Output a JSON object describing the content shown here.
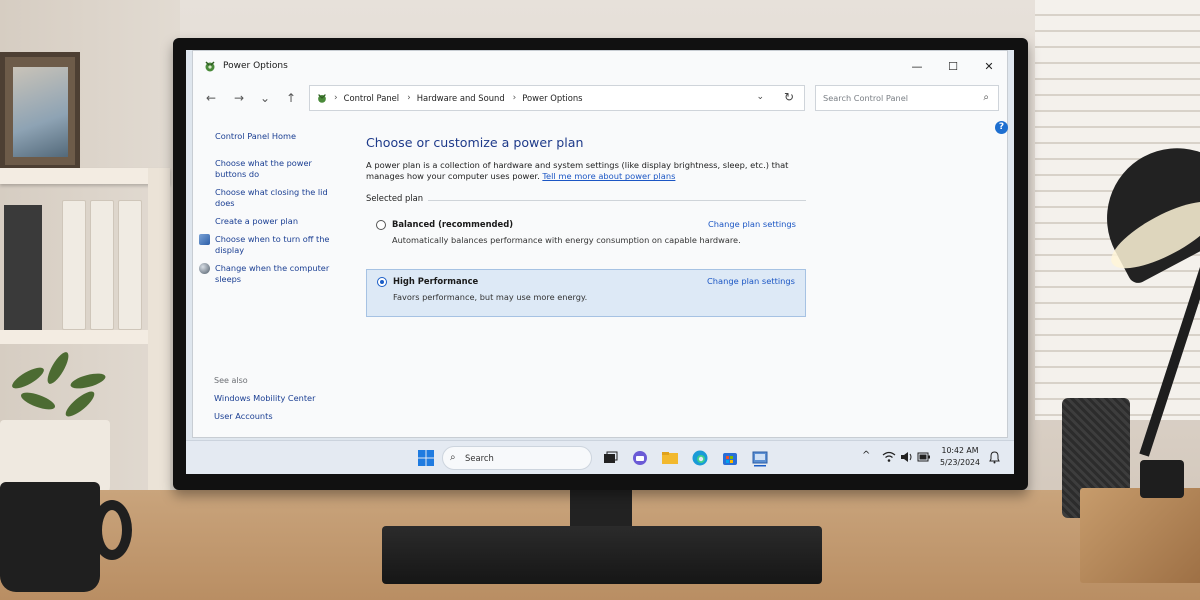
{
  "window": {
    "title": "Power Options",
    "minimize_glyph": "—",
    "maximize_glyph": "☐",
    "close_glyph": "✕"
  },
  "nav": {
    "back": "←",
    "forward": "→",
    "recent": "⌄",
    "up": "↑",
    "breadcrumb": [
      "Control Panel",
      "Hardware and Sound",
      "Power Options"
    ],
    "sep": "›",
    "dropdown": "⌄",
    "refresh": "↻",
    "search_placeholder": "Search Control Panel",
    "search_icon": "⌕"
  },
  "help": "?",
  "sidebar": {
    "home": "Control Panel Home",
    "links": [
      "Choose what the power buttons do",
      "Choose what closing the lid does",
      "Create a power plan",
      "Choose when to turn off the display",
      "Change when the computer sleeps"
    ],
    "see_also_title": "See also",
    "see_also": [
      "Windows Mobility Center",
      "User Accounts"
    ]
  },
  "main": {
    "heading": "Choose or customize a power plan",
    "description": "A power plan is a collection of hardware and system settings (like display brightness, sleep, etc.) that manages how your computer uses power.",
    "description_link": "Tell me more about power plans",
    "selected_plan_label": "Selected plan",
    "plans": [
      {
        "name": "Balanced (recommended)",
        "description": "Automatically balances performance with energy consumption on capable hardware.",
        "link": "Change plan settings",
        "selected": false
      },
      {
        "name": "High Performance",
        "description": "Favors performance, but may use more energy.",
        "link": "Change plan settings",
        "selected": true
      }
    ]
  },
  "taskbar": {
    "search_label": "Search",
    "time": "10:42 AM",
    "date": "5/23/2024",
    "tray_chevron": "^",
    "icons": [
      "windows-start-icon",
      "task-view-icon",
      "chat-icon",
      "file-explorer-icon",
      "edge-icon",
      "store-icon",
      "control-panel-icon"
    ]
  },
  "colors": {
    "link": "#1b3f93",
    "heading": "#1e3a8a",
    "selected_plan_bg": "#dde9f6",
    "accent": "#1b5ec7"
  }
}
